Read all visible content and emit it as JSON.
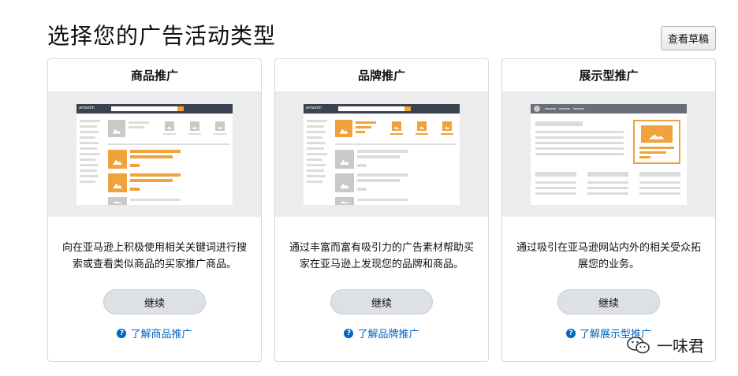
{
  "header": {
    "title": "选择您的广告活动类型",
    "draft_label": "查看草稿"
  },
  "cards": [
    {
      "title": "商品推广",
      "description": "向在亚马逊上积极使用相关关键词进行搜索或查看类似商品的买家推广商品。",
      "continue_label": "继续",
      "learn_label": "了解商品推广"
    },
    {
      "title": "品牌推广",
      "description": "通过丰富而富有吸引力的广告素材帮助买家在亚马逊上发现您的品牌和商品。",
      "continue_label": "继续",
      "learn_label": "了解品牌推广"
    },
    {
      "title": "展示型推广",
      "description": "通过吸引在亚马逊网站内外的相关受众拓展您的业务。",
      "continue_label": "继续",
      "learn_label": "了解展示型推广"
    }
  ],
  "mock_logo": "amazon",
  "watermark": "一味君",
  "colors": {
    "accent_orange": "#f0a33c",
    "link_blue": "#0066c0",
    "header_dark": "#3b4350",
    "button_gray": "#dde0e5"
  },
  "icons": [
    "help-circle-icon",
    "wechat-icon"
  ]
}
